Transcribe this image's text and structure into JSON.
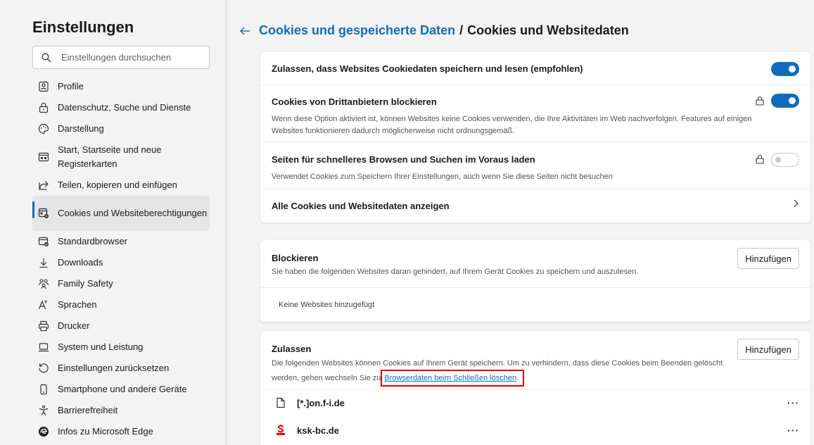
{
  "sidebar": {
    "title": "Einstellungen",
    "search_placeholder": "Einstellungen durchsuchen",
    "items": [
      {
        "label": "Profile"
      },
      {
        "label": "Datenschutz, Suche und Dienste"
      },
      {
        "label": "Darstellung"
      },
      {
        "label": "Start, Startseite und neue Registerkarten"
      },
      {
        "label": "Teilen, kopieren und einfügen"
      },
      {
        "label": "Cookies und Websiteberechtigungen"
      },
      {
        "label": "Standardbrowser"
      },
      {
        "label": "Downloads"
      },
      {
        "label": "Family Safety"
      },
      {
        "label": "Sprachen"
      },
      {
        "label": "Drucker"
      },
      {
        "label": "System und Leistung"
      },
      {
        "label": "Einstellungen zurücksetzen"
      },
      {
        "label": "Smartphone und andere Geräte"
      },
      {
        "label": "Barrierefreiheit"
      },
      {
        "label": "Infos zu Microsoft Edge"
      }
    ]
  },
  "header": {
    "back_icon": "arrow-left-icon",
    "crumb_link": "Cookies und gespeicherte Daten",
    "separator": "/",
    "current": "Cookies und Websitedaten"
  },
  "settings": {
    "allow_cookies": {
      "title": "Zulassen, dass Websites Cookiedaten speichern und lesen (empfohlen)",
      "enabled": true
    },
    "block_third_party": {
      "title": "Cookies von Drittanbietern blockieren",
      "desc": "Wenn diese Option aktiviert ist, können Websites keine Cookies verwenden, die Ihre Aktivitäten im Web nachverfolgen. Features auf einigen Websites funktionieren dadurch möglicherweise nicht ordnungsgemäß.",
      "enabled": true
    },
    "preload": {
      "title": "Seiten für schnelleres Browsen und Suchen im Voraus laden",
      "desc": "Verwendet Cookies zum Speichern Ihrer Einstellungen, auch wenn Sie diese Seiten nicht besuchen",
      "enabled": false
    },
    "see_all": {
      "title": "Alle Cookies und Websitedaten anzeigen"
    }
  },
  "block": {
    "title": "Blockieren",
    "desc": "Sie haben die folgenden Websites daran gehindert, auf Ihrem Gerät Cookies zu speichern und auszulesen.",
    "button": "Hinzufügen",
    "empty": "Keine Websites hinzugefügt"
  },
  "allow": {
    "title": "Zulassen",
    "desc_part1": "Die folgenden Websites können Cookies auf Ihrem Gerät speichern. Um zu verhindern, dass diese Cookies beim Beenden gelöscht",
    "desc_part2": "werden, gehen wechseln Sie zu ",
    "link": "Browserdaten beim Schließen löschen",
    "link_suffix": ".",
    "button": "Hinzufügen",
    "sites": [
      {
        "name": "[*.]on.f-i.de",
        "icon": "file-icon"
      },
      {
        "name": "ksk-bc.de",
        "icon": "sparkasse-icon"
      }
    ],
    "more": "···"
  },
  "colors": {
    "accent": "#0f6cbd",
    "highlight": "#e00000"
  }
}
